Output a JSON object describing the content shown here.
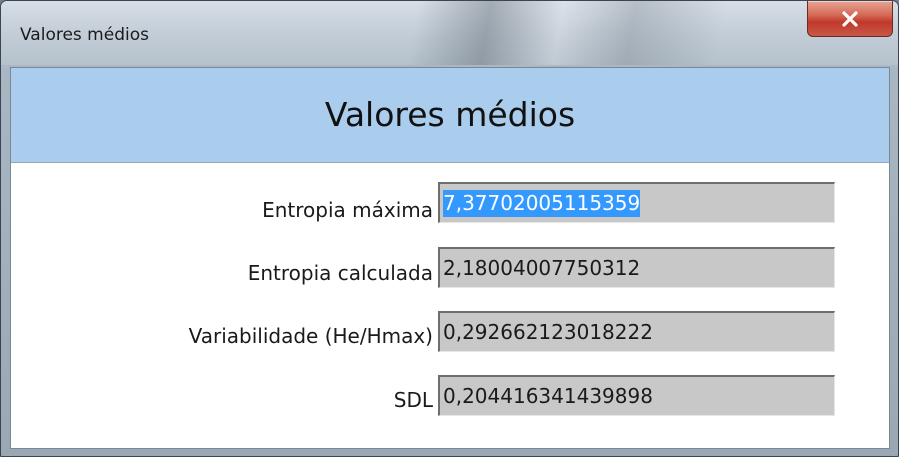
{
  "window": {
    "title": "Valores médios",
    "close_glyph": "X"
  },
  "header": {
    "title": "Valores médios"
  },
  "fields": [
    {
      "label": "Entropia máxima",
      "value": "7,37702005115359",
      "selected": true
    },
    {
      "label": "Entropia calculada",
      "value": "2,18004007750312",
      "selected": false
    },
    {
      "label": "Variabilidade (He/Hmax)",
      "value": "0,292662123018222",
      "selected": false
    },
    {
      "label": "SDL",
      "value": "0,204416341439898",
      "selected": false
    }
  ],
  "colors": {
    "header_band": "#aacdee",
    "field_background": "#c8c8c8",
    "selection": "#3399ff",
    "close_button": "#c0392b"
  }
}
